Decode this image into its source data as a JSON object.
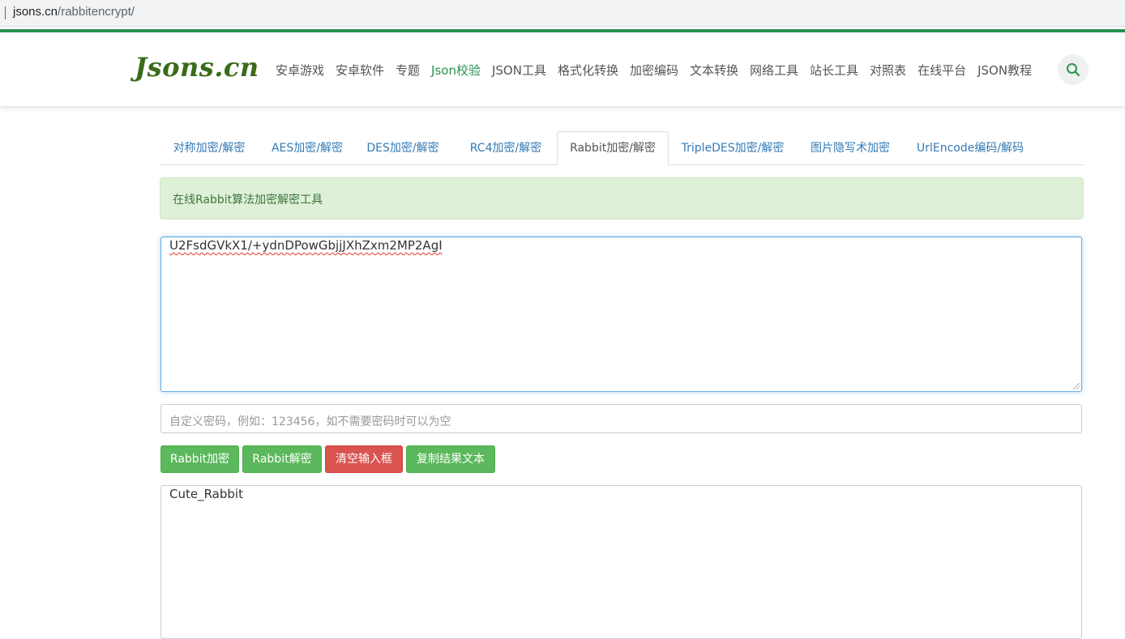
{
  "browser": {
    "url_host": "jsons.cn",
    "url_path": "/rabbitencrypt/"
  },
  "header": {
    "logo": "Jsons.cn",
    "nav": [
      {
        "label": "安卓游戏",
        "active": false
      },
      {
        "label": "安卓软件",
        "active": false
      },
      {
        "label": "专题",
        "active": false
      },
      {
        "label": "Json校验",
        "active": true
      },
      {
        "label": "JSON工具",
        "active": false
      },
      {
        "label": "格式化转换",
        "active": false
      },
      {
        "label": "加密编码",
        "active": false
      },
      {
        "label": "文本转换",
        "active": false
      },
      {
        "label": "网络工具",
        "active": false
      },
      {
        "label": "站长工具",
        "active": false
      },
      {
        "label": "对照表",
        "active": false
      },
      {
        "label": "在线平台",
        "active": false
      },
      {
        "label": "JSON教程",
        "active": false
      }
    ],
    "search_icon": "search-icon"
  },
  "tabs": [
    {
      "label": "对称加密/解密",
      "active": false
    },
    {
      "label": "AES加密/解密",
      "active": false
    },
    {
      "label": "DES加密/解密",
      "active": false
    },
    {
      "label": "RC4加密/解密",
      "active": false
    },
    {
      "label": "Rabbit加密/解密",
      "active": true
    },
    {
      "label": "TripleDES加密/解密",
      "active": false
    },
    {
      "label": "图片隐写术加密",
      "active": false
    },
    {
      "label": "UrlEncode编码/解码",
      "active": false
    }
  ],
  "alert": {
    "text": "在线Rabbit算法加密解密工具"
  },
  "input": {
    "value": "U2FsdGVkX1/+ydnDPowGbjjJXhZxm2MP2AgI"
  },
  "password": {
    "placeholder": "自定义密码，例如：123456，如不需要密码时可以为空"
  },
  "buttons": {
    "encrypt": "Rabbit加密",
    "decrypt": "Rabbit解密",
    "clear": "清空输入框",
    "copy": "复制结果文本"
  },
  "output": {
    "value": "Cute_Rabbit"
  },
  "colors": {
    "brand_green": "#2b9250",
    "logo_green": "#3a6b1a",
    "tab_link": "#337ab7",
    "btn_green": "#5cb85c",
    "btn_red": "#d9534f",
    "alert_bg": "#dff0d8",
    "alert_text": "#3c763d"
  }
}
